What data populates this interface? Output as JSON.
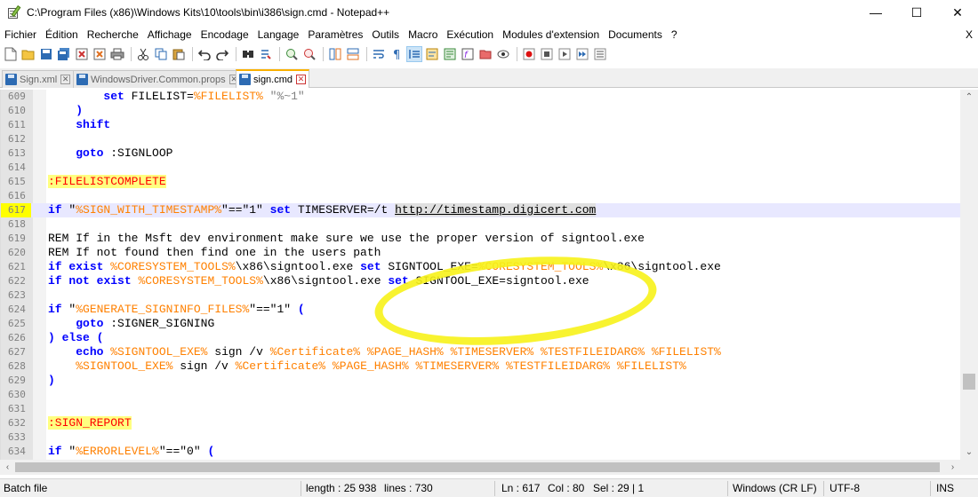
{
  "window": {
    "title": "C:\\Program Files (x86)\\Windows Kits\\10\\tools\\bin\\i386\\sign.cmd - Notepad++",
    "minimize": "—",
    "maximize": "☐",
    "close": "✕"
  },
  "menu": {
    "items": [
      "Fichier",
      "Édition",
      "Recherche",
      "Affichage",
      "Encodage",
      "Langage",
      "Paramètres",
      "Outils",
      "Macro",
      "Exécution",
      "Modules d'extension",
      "Documents",
      "?"
    ],
    "close": "X"
  },
  "toolbar": {
    "icons": [
      "new-file-icon",
      "open-file-icon",
      "save-icon",
      "save-all-icon",
      "close-icon",
      "close-all-icon",
      "print-icon",
      "cut-icon",
      "copy-icon",
      "paste-icon",
      "undo-icon",
      "redo-icon",
      "find-icon",
      "replace-icon",
      "zoom-in-icon",
      "zoom-out-icon",
      "sync-v-icon",
      "sync-h-icon",
      "word-wrap-icon",
      "show-all-chars-icon",
      "indent-guide-icon",
      "udl-icon",
      "doc-map-icon",
      "function-list-icon",
      "folder-workspace-icon",
      "monitoring-icon",
      "record-macro-icon",
      "stop-macro-icon",
      "play-macro-icon",
      "run-macro-multiple-icon",
      "save-macro-icon"
    ]
  },
  "tabs": [
    {
      "label": "Sign.xml",
      "active": false
    },
    {
      "label": "WindowsDriver.Common.props",
      "active": false
    },
    {
      "label": "sign.cmd",
      "active": true
    }
  ],
  "editor": {
    "lines": [
      {
        "n": "609",
        "current": false
      },
      {
        "n": "610",
        "current": false
      },
      {
        "n": "611",
        "current": false
      },
      {
        "n": "612",
        "current": false
      },
      {
        "n": "613",
        "current": false
      },
      {
        "n": "614",
        "current": false
      },
      {
        "n": "615",
        "current": false
      },
      {
        "n": "616",
        "current": false
      },
      {
        "n": "617",
        "current": true
      },
      {
        "n": "618",
        "current": false
      },
      {
        "n": "619",
        "current": false
      },
      {
        "n": "620",
        "current": false
      },
      {
        "n": "621",
        "current": false
      },
      {
        "n": "622",
        "current": false
      },
      {
        "n": "623",
        "current": false
      },
      {
        "n": "624",
        "current": false
      },
      {
        "n": "625",
        "current": false
      },
      {
        "n": "626",
        "current": false
      },
      {
        "n": "627",
        "current": false
      },
      {
        "n": "628",
        "current": false
      },
      {
        "n": "629",
        "current": false
      },
      {
        "n": "630",
        "current": false
      },
      {
        "n": "631",
        "current": false
      },
      {
        "n": "632",
        "current": false
      },
      {
        "n": "633",
        "current": false
      },
      {
        "n": "634",
        "current": false
      }
    ],
    "code": {
      "l609": [
        "        ",
        "set",
        " FILELIST=",
        "%FILELIST%",
        " ",
        "\"%~1\""
      ],
      "l610": [
        "    ",
        ")"
      ],
      "l611": [
        "    ",
        "shift"
      ],
      "l613": [
        "    ",
        "goto",
        " :SIGNLOOP"
      ],
      "l615": [
        ":FILELISTCOMPLETE"
      ],
      "l617": [
        "if",
        " \"",
        "%SIGN_WITH_TIMESTAMP%",
        "\"==\"1\" ",
        "set",
        " TIMESERVER=/t ",
        "http://timestamp.digicert.com"
      ],
      "l619": [
        "REM If in the Msft dev environment make sure we use the proper version of signtool.exe"
      ],
      "l620": [
        "REM If not found then find one in the users path"
      ],
      "l621": [
        "if",
        " ",
        "exist",
        " ",
        "%CORESYSTEM_TOOLS%",
        "\\x86\\signtool.exe ",
        "set",
        " SIGNTOOL_EXE=",
        "%CORESYSTEM_TOOLS%",
        "\\x86\\signtool.exe"
      ],
      "l622": [
        "if",
        " ",
        "not",
        " ",
        "exist",
        " ",
        "%CORESYSTEM_TOOLS%",
        "\\x86\\signtool.exe ",
        "set",
        " SIGNTOOL_EXE=signtool.exe"
      ],
      "l624": [
        "if",
        " \"",
        "%GENERATE_SIGNINFO_FILES%",
        "\"==\"1\" ",
        "("
      ],
      "l625": [
        "    ",
        "goto",
        " :SIGNER_SIGNING"
      ],
      "l626": [
        ")",
        " ",
        "else",
        " ",
        "("
      ],
      "l627": [
        "    ",
        "echo",
        " ",
        "%SIGNTOOL_EXE%",
        " sign /v ",
        "%Certificate%",
        " ",
        "%PAGE_HASH%",
        " ",
        "%TIMESERVER%",
        " ",
        "%TESTFILEIDARG%",
        " ",
        "%FILELIST%"
      ],
      "l628": [
        "    ",
        "%SIGNTOOL_EXE%",
        " sign /v ",
        "%Certificate%",
        " ",
        "%PAGE_HASH%",
        " ",
        "%TIMESERVER%",
        " ",
        "%TESTFILEIDARG%",
        " ",
        "%FILELIST%"
      ],
      "l629": [
        ")"
      ],
      "l632": [
        ":SIGN_REPORT"
      ],
      "l634": [
        "if",
        " \"",
        "%ERRORLEVEL%",
        "\"==\"0\" ",
        "("
      ]
    }
  },
  "status": {
    "file_type": "Batch file",
    "length": "length : 25 938",
    "lines": "lines : 730",
    "ln": "Ln : 617",
    "col": "Col : 80",
    "sel": "Sel : 29 | 1",
    "eol": "Windows (CR LF)",
    "encoding": "UTF-8",
    "mode": "INS"
  },
  "colors": {
    "keyword": "#0000ff",
    "variable": "#ff8000",
    "comment": "#008000",
    "label": "#ff0000",
    "label_bg": "#ffff80",
    "highlight_ring": "#f7f219",
    "current_line": "#e8e8ff"
  }
}
